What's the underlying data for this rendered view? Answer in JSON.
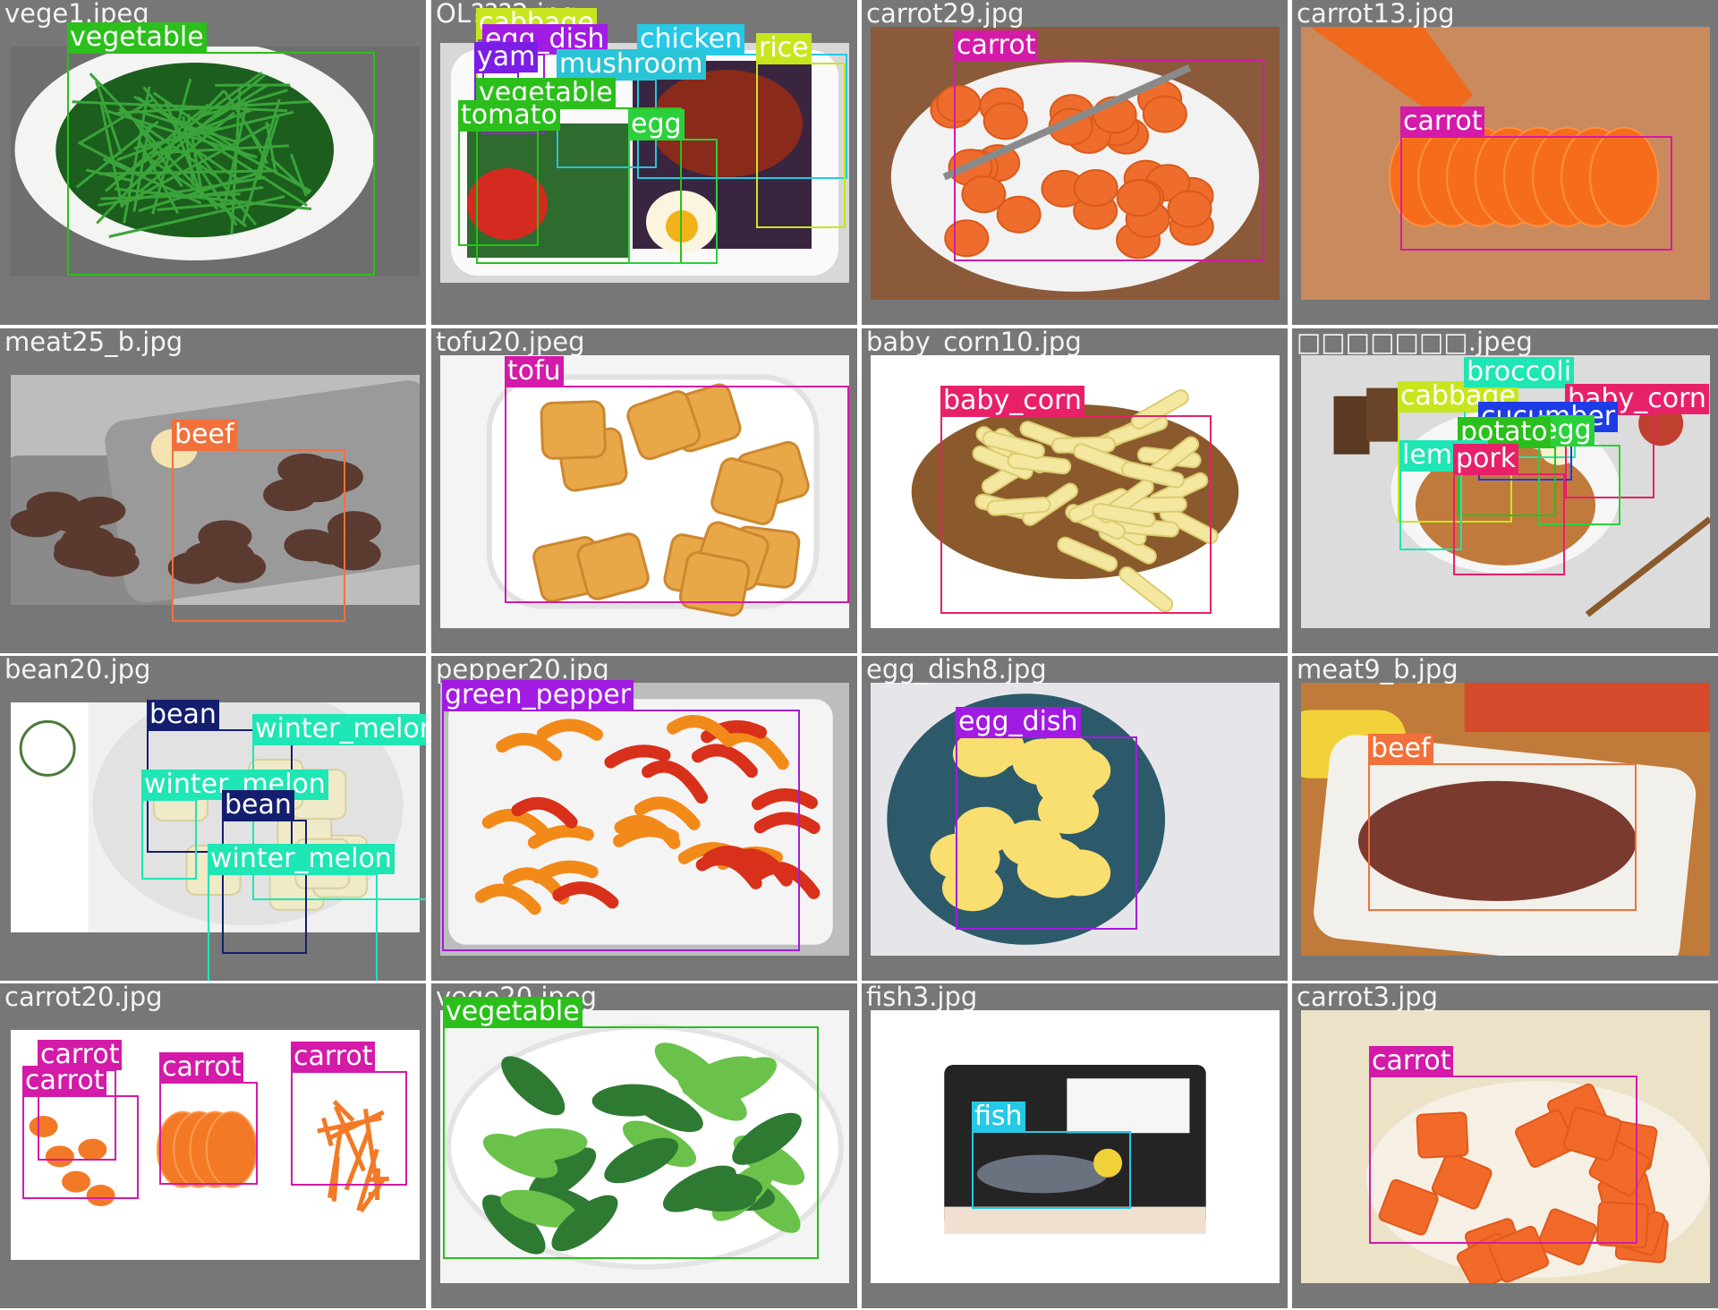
{
  "mosaic": {
    "tiles": [
      {
        "file": "vege1.jpeg",
        "scene": "green-plate",
        "detections": [
          {
            "label": "vegetable",
            "color": "#2bbf1b"
          }
        ]
      },
      {
        "file": "OL???2.jpg",
        "scene": "lunchbox",
        "detections": [
          {
            "label": "cabbage",
            "color": "#c8e61e"
          },
          {
            "label": "chicken",
            "color": "#25c9e6"
          },
          {
            "label": "rice",
            "color": "#c8e61e"
          },
          {
            "label": "egg_dish",
            "color": "#a21be3"
          },
          {
            "label": "yam",
            "color": "#7a1ee6"
          },
          {
            "label": "mushroom",
            "color": "#29c4d6"
          },
          {
            "label": "vegetable",
            "color": "#2bbf1b"
          },
          {
            "label": "tomato",
            "color": "#2bbf1b"
          },
          {
            "label": "egg",
            "color": "#2bd13b"
          }
        ]
      },
      {
        "file": "carrot29.jpg",
        "scene": "carrot-plate",
        "detections": [
          {
            "label": "carrot",
            "color": "#d41aa8"
          }
        ]
      },
      {
        "file": "carrot13.jpg",
        "scene": "carrot-board",
        "detections": [
          {
            "label": "carrot",
            "color": "#d41aa8"
          }
        ]
      },
      {
        "file": "meat25_b.jpg",
        "scene": "meat-tray",
        "detections": [
          {
            "label": "beef",
            "color": "#f2703a"
          }
        ]
      },
      {
        "file": "tofu20.jpeg",
        "scene": "tofu-plate",
        "detections": [
          {
            "label": "tofu",
            "color": "#d41aa8"
          }
        ]
      },
      {
        "file": "baby_corn10.jpg",
        "scene": "corn-bowl",
        "detections": [
          {
            "label": "baby_corn",
            "color": "#e8206a"
          }
        ]
      },
      {
        "file": "□□□□□□□.jpeg",
        "scene": "mixed-bowl",
        "detections": [
          {
            "label": "cabbage",
            "color": "#c8e61e"
          },
          {
            "label": "broccoli",
            "color": "#1ee6b4"
          },
          {
            "label": "baby_corn",
            "color": "#e8206a"
          },
          {
            "label": "cucumber",
            "color": "#1e3ce6"
          },
          {
            "label": "egg",
            "color": "#2bd13b"
          },
          {
            "label": "potato",
            "color": "#2bbf1b"
          },
          {
            "label": "lemon",
            "color": "#1ee6b4"
          },
          {
            "label": "pork",
            "color": "#e8206a"
          }
        ]
      },
      {
        "file": "bean20.jpg",
        "scene": "melon-bowl",
        "detections": [
          {
            "label": "bean",
            "color": "#141e6e"
          },
          {
            "label": "winter_melon",
            "color": "#1ee6b4"
          },
          {
            "label": "winter_melon",
            "color": "#1ee6b4"
          },
          {
            "label": "bean",
            "color": "#141e6e"
          },
          {
            "label": "winter_melon",
            "color": "#1ee6b4"
          }
        ]
      },
      {
        "file": "pepper20.jpg",
        "scene": "pepper-plate",
        "detections": [
          {
            "label": "green_pepper",
            "color": "#a21be3"
          }
        ]
      },
      {
        "file": "egg_dish8.jpg",
        "scene": "egg-bowl",
        "detections": [
          {
            "label": "egg_dish",
            "color": "#a21be3"
          }
        ]
      },
      {
        "file": "meat9_b.jpg",
        "scene": "beef-box",
        "detections": [
          {
            "label": "beef",
            "color": "#f2703a"
          }
        ]
      },
      {
        "file": "carrot20.jpg",
        "scene": "carrot-cuts",
        "detections": [
          {
            "label": "carrot",
            "color": "#d41aa8"
          },
          {
            "label": "carrot",
            "color": "#d41aa8"
          },
          {
            "label": "carrot",
            "color": "#d41aa8"
          },
          {
            "label": "carrot",
            "color": "#d41aa8"
          }
        ]
      },
      {
        "file": "vege20.jpeg",
        "scene": "greens-plate",
        "detections": [
          {
            "label": "vegetable",
            "color": "#2bbf1b"
          }
        ]
      },
      {
        "file": "fish3.jpg",
        "scene": "fish-bento",
        "detections": [
          {
            "label": "fish",
            "color": "#25c9e6"
          }
        ]
      },
      {
        "file": "carrot3.jpg",
        "scene": "carrot-chunks",
        "detections": [
          {
            "label": "carrot",
            "color": "#d41aa8"
          }
        ]
      }
    ]
  }
}
